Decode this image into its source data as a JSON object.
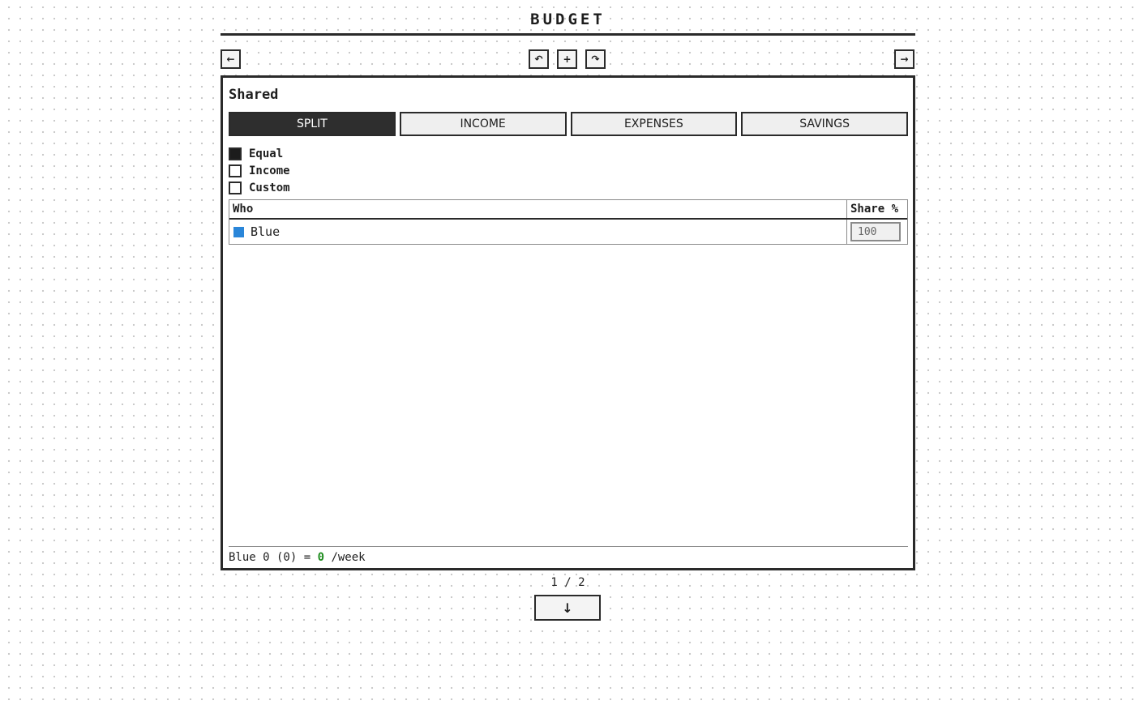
{
  "app": {
    "title": "BUDGET"
  },
  "toolbar": {
    "prev_label": "←",
    "undo_label": "↶",
    "add_label": "+",
    "redo_label": "↷",
    "next_label": "→"
  },
  "panel": {
    "title": "Shared",
    "tabs": [
      {
        "label": "SPLIT",
        "active": true
      },
      {
        "label": "INCOME",
        "active": false
      },
      {
        "label": "EXPENSES",
        "active": false
      },
      {
        "label": "SAVINGS",
        "active": false
      }
    ],
    "split_options": [
      {
        "label": "Equal",
        "checked": true
      },
      {
        "label": "Income",
        "checked": false
      },
      {
        "label": "Custom",
        "checked": false
      }
    ],
    "table": {
      "columns": [
        "Who",
        "Share %"
      ],
      "rows": [
        {
          "name": "Blue",
          "color": "#2a86d9",
          "share": "100"
        }
      ]
    },
    "summary": {
      "text_before": "Blue 0 (0) = ",
      "total": "0",
      "text_after": " /week"
    }
  },
  "pager": {
    "text": "1 / 2",
    "down_label": "↓"
  },
  "colors": {
    "active_tab": "#2e2e2e",
    "total_value": "#1e8c1e",
    "person_blue": "#2a86d9"
  }
}
